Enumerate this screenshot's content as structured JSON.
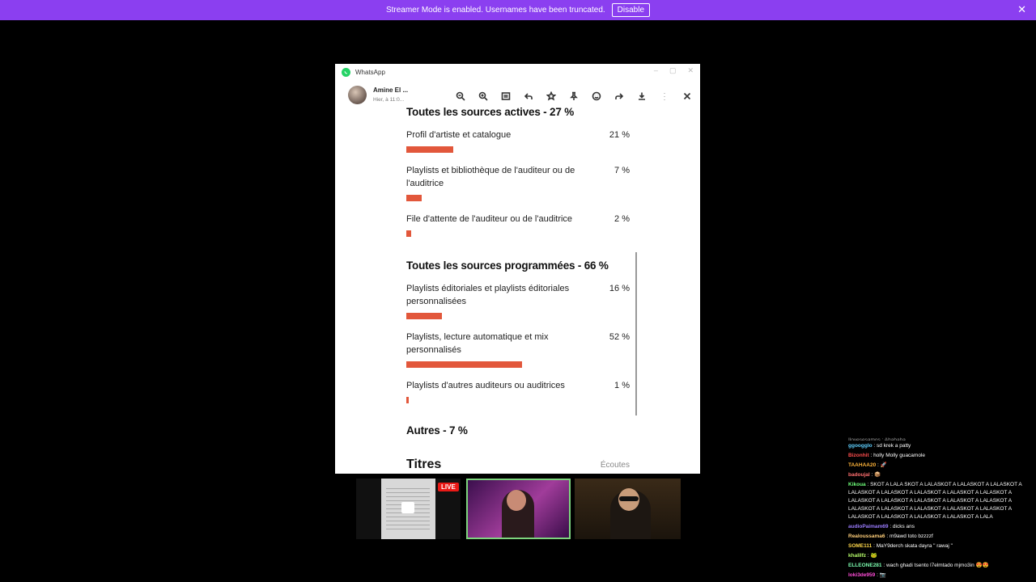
{
  "banner": {
    "message": "Streamer Mode is enabled. Usernames have been truncated.",
    "disable_label": "Disable",
    "close_glyph": "✕"
  },
  "whatsapp": {
    "window_title": "WhatsApp",
    "window_controls": [
      "–",
      "▢",
      "✕"
    ],
    "contact_name": "Amine El ...",
    "contact_time": "Hier, à 11:0...",
    "toolbar_icons": [
      "zoom-out-icon",
      "zoom-in-icon",
      "view-icon",
      "reply-icon",
      "star-icon",
      "pin-icon",
      "emoji-icon",
      "forward-icon",
      "download-icon",
      "more-icon",
      "close-icon"
    ],
    "accent_color": "#25d366",
    "bar_color": "#e2573b"
  },
  "document": {
    "sections": [
      {
        "title": "Toutes les sources actives - 27 %",
        "rows": [
          {
            "label": "Profil d'artiste et catalogue",
            "pct": "21 %",
            "value": 21
          },
          {
            "label": "Playlists et bibliothèque de l'auditeur ou de l'auditrice",
            "pct": "7 %",
            "value": 7
          },
          {
            "label": "File d'attente de l'auditeur ou de l'auditrice",
            "pct": "2 %",
            "value": 2
          }
        ]
      },
      {
        "title": "Toutes les sources programmées - 66 %",
        "rows": [
          {
            "label": "Playlists éditoriales et playlists éditoriales personnalisées",
            "pct": "16 %",
            "value": 16
          },
          {
            "label": "Playlists, lecture automatique et mix personnalisés",
            "pct": "52 %",
            "value": 52
          },
          {
            "label": "Playlists d'autres auditeurs ou auditrices",
            "pct": "1 %",
            "value": 1
          }
        ]
      }
    ],
    "others_title": "Autres - 7 %",
    "next_title": "Titres",
    "next_title_right": "Écoutes"
  },
  "stream": {
    "live_label": "LIVE"
  },
  "chat": {
    "top_cut": "Ilovesesamos : Ahahaha...",
    "messages": [
      {
        "user": "ggoogglo",
        "color": "#5fd0ff",
        "text": ": sd krek a patty"
      },
      {
        "user": "Bizonhit",
        "color": "#ff4d4d",
        "text": ": holly Molly guacamole"
      },
      {
        "user": "TAAHAA20",
        "color": "#ffb43a",
        "text": ": 🚀"
      },
      {
        "user": "badoujal",
        "color": "#ff6f6f",
        "text": ": 📦"
      },
      {
        "user": "Kikoua",
        "color": "#6fff7a",
        "text": ": SKOT A LALA SKOT A LALASKOT A LALASKOT A LALASKOT A LALASKOT A LALASKOT A LALASKOT A LALASKOT A LALASKOT A LALASKOT A LALASKOT A LALASKOT A LALASKOT A LALASKOT A LALASKOT A LALASKOT A LALASKOT A LALASKOT A LALASKOT A LALASKOT A LALASKOT A LALASKOT A LALASKOT A LALA"
      },
      {
        "user": "audioPaimam69",
        "color": "#9b7cff",
        "text": ": dicks ans"
      },
      {
        "user": "Realoussama6",
        "color": "#ffcf7a",
        "text": ": m9awd toto bzzzzf"
      },
      {
        "user": "SOME111",
        "color": "#ffd84a",
        "text": ": MaY9derch skata dayra \" rawaj \""
      },
      {
        "user": "khalilfz",
        "color": "#b8ff6b",
        "text": ": 🐸"
      },
      {
        "user": "ELLEONE281",
        "color": "#7dffb1",
        "text": ": wach ghadi tsento l7elmtado mjmo3in 😍😍"
      },
      {
        "user": "loki3de959",
        "color": "#ff4dd8",
        "text": ": 📷"
      }
    ]
  }
}
